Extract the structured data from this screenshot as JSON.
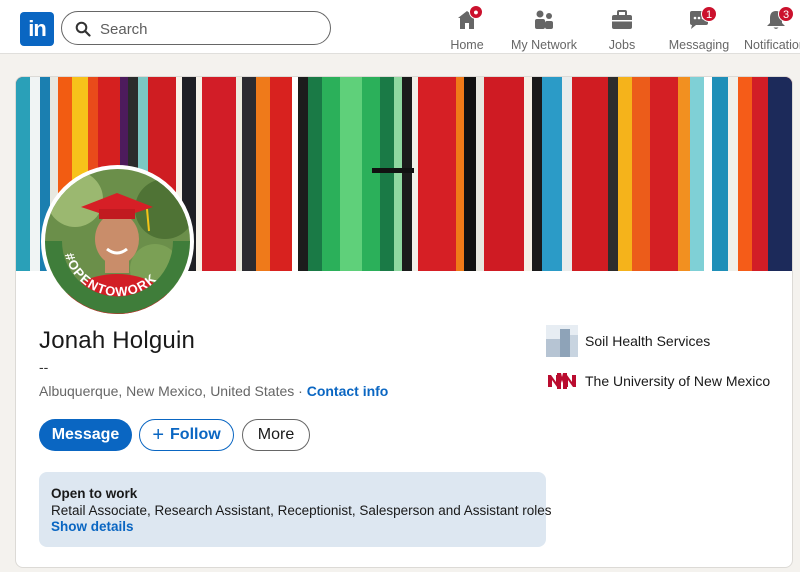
{
  "search": {
    "placeholder": "Search"
  },
  "nav": {
    "items": [
      {
        "label": "Home",
        "icon": "home-icon",
        "badge": ""
      },
      {
        "label": "My Network",
        "icon": "network-icon",
        "badge": ""
      },
      {
        "label": "Jobs",
        "icon": "briefcase-icon",
        "badge": ""
      },
      {
        "label": "Messaging",
        "icon": "messaging-icon",
        "badge": "1"
      },
      {
        "label": "Notifications",
        "icon": "bell-icon",
        "badge": "3"
      }
    ]
  },
  "profile": {
    "name": "Jonah Holguin",
    "headline": "--",
    "location": "Albuquerque, New Mexico, United States",
    "separator": " · ",
    "contact_label": "Contact info",
    "badge_text": "#OPENTOWORK"
  },
  "actions": {
    "message_label": "Message",
    "follow_plus": "+",
    "follow_label": "Follow",
    "more_label": "More"
  },
  "open_to_work": {
    "title": "Open to work",
    "roles": "Retail Associate, Research Assistant, Receptionist, Salesperson and Assistant roles",
    "link": "Show details"
  },
  "organizations": [
    {
      "name": "Soil Health Services",
      "icon": "company-logo"
    },
    {
      "name": "The University of New Mexico",
      "icon": "unm-logo"
    }
  ],
  "colors": {
    "brand": "#0a66c2",
    "badge_red": "#cb112d",
    "open_to_work_green": "#3f7d3a",
    "card_bg": "#ffffff",
    "page_bg": "#f4f2ee",
    "otw_bg": "#dde7f1"
  }
}
